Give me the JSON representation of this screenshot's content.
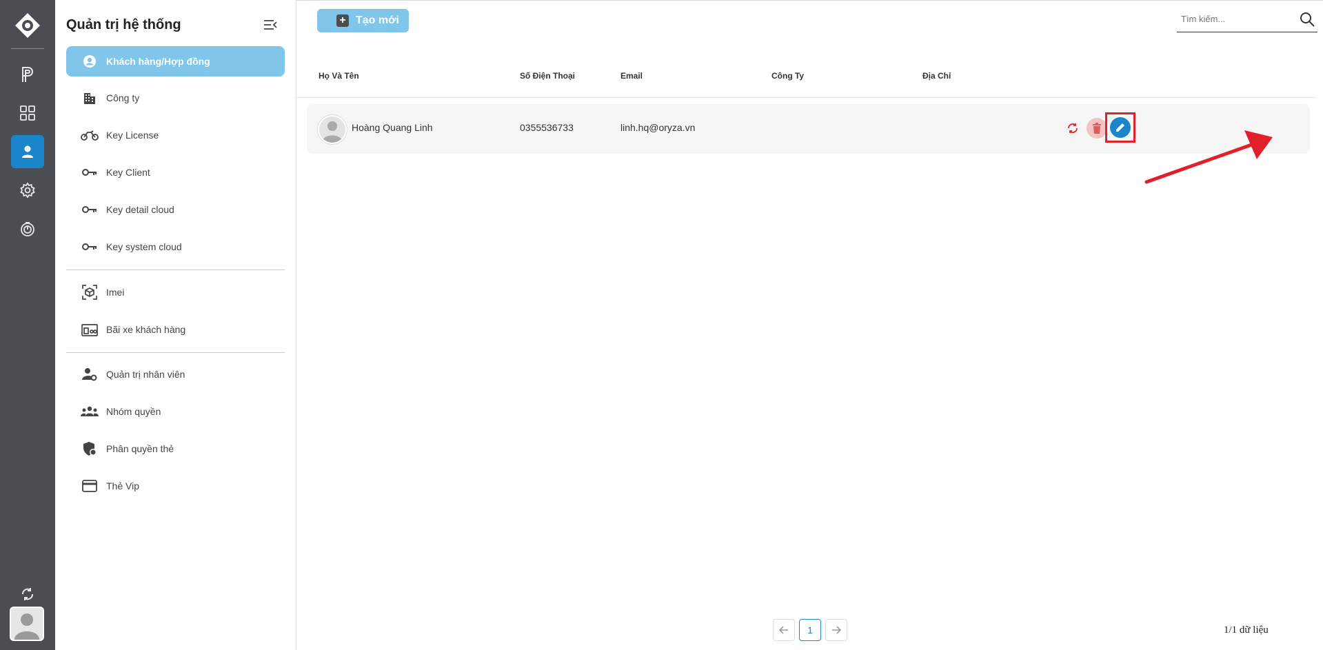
{
  "rail": {
    "items": [
      {
        "name": "parking-icon"
      },
      {
        "name": "dashboard-grid-icon"
      },
      {
        "name": "user-icon",
        "active": true
      },
      {
        "name": "settings-gear-icon"
      },
      {
        "name": "history-timer-icon"
      }
    ],
    "bottom": [
      "refresh-icon",
      "avatar"
    ]
  },
  "sidebar": {
    "title": "Quản trị hệ thống",
    "groups": [
      {
        "label": "Khách hàng/Hợp đồng",
        "icon": "account-circle-icon",
        "active": true
      },
      {
        "label": "Công ty",
        "icon": "building-icon"
      },
      {
        "label": "Key License",
        "icon": "motorbike-icon"
      },
      {
        "label": "Key Client",
        "icon": "key-icon"
      },
      {
        "label": "Key detail cloud",
        "icon": "key-icon"
      },
      {
        "label": "Key system cloud",
        "icon": "key-icon"
      },
      {
        "label": "Imei",
        "icon": "cube-scan-icon"
      },
      {
        "label": "Bãi xe khách hàng",
        "icon": "parking-lot-icon"
      },
      {
        "label": "Quản trị nhân viên",
        "icon": "user-gear-icon"
      },
      {
        "label": "Nhóm quyền",
        "icon": "group-icon"
      },
      {
        "label": "Phân quyền thẻ",
        "icon": "shield-user-icon"
      },
      {
        "label": "Thẻ Vip",
        "icon": "credit-card-icon"
      }
    ]
  },
  "toolbar": {
    "create_label": "Tạo mới",
    "search_placeholder": "Tìm kiếm..."
  },
  "table": {
    "headers": [
      "Họ Và Tên",
      "Số Điện Thoại",
      "Email",
      "Công Ty",
      "Địa Chỉ"
    ],
    "rows": [
      {
        "name": "Hoàng Quang Linh",
        "phone": "0355536733",
        "email": "linh.hq@oryza.vn",
        "company": "",
        "address": ""
      }
    ]
  },
  "pagination": {
    "current": "1",
    "summary": "1/1 dữ liệu"
  },
  "colors": {
    "accent": "#1a86c9",
    "active_menu": "#7fc6ea",
    "rail_bg": "#4a4d52",
    "highlight": "#e0202a"
  }
}
